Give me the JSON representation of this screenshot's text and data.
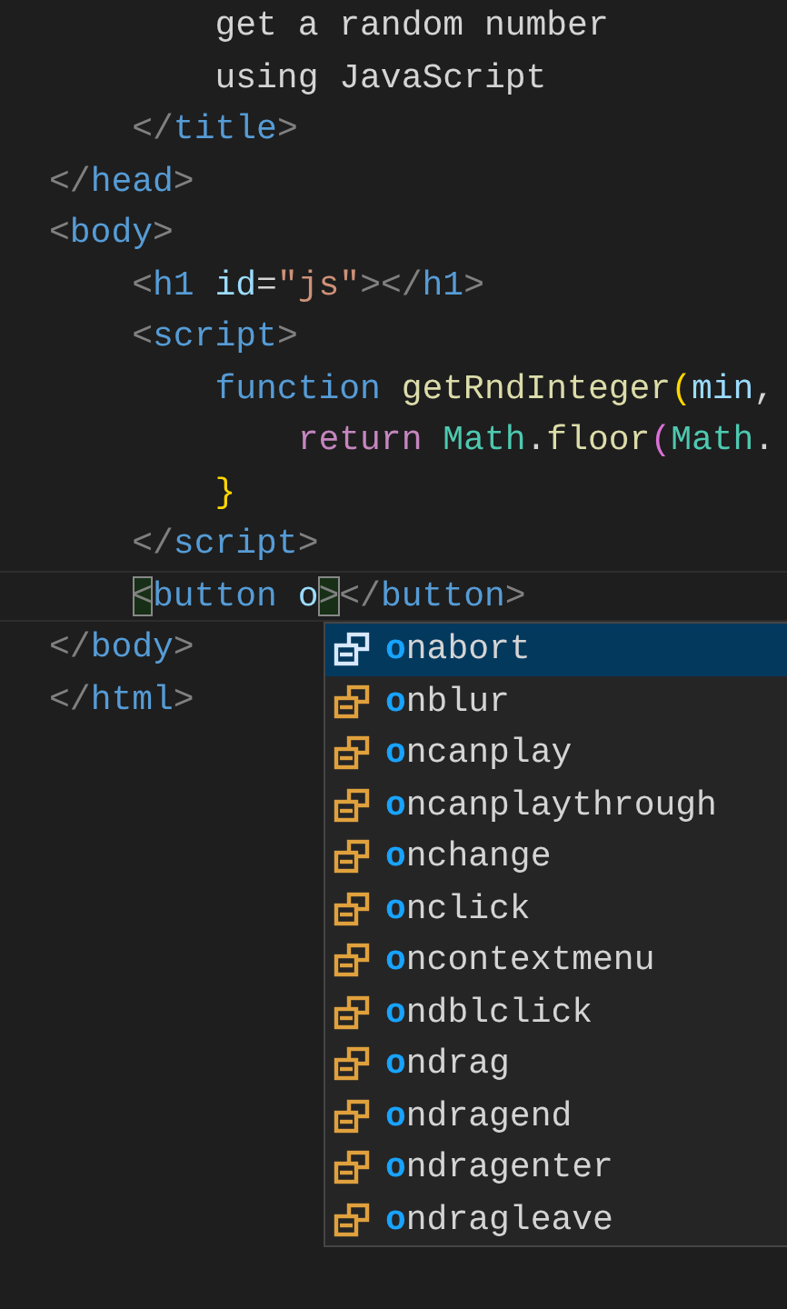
{
  "editor": {
    "lines": [
      {
        "current": false,
        "tokens": [
          {
            "kind": "text",
            "text": "        get a random number"
          }
        ]
      },
      {
        "current": false,
        "tokens": [
          {
            "kind": "text",
            "text": "        using JavaScript"
          }
        ]
      },
      {
        "current": false,
        "tokens": [
          {
            "kind": "punct",
            "text": "    </"
          },
          {
            "kind": "tag",
            "text": "title"
          },
          {
            "kind": "punct",
            "text": ">"
          }
        ]
      },
      {
        "current": false,
        "tokens": [
          {
            "kind": "punct",
            "text": "</"
          },
          {
            "kind": "tag",
            "text": "head"
          },
          {
            "kind": "punct",
            "text": ">"
          }
        ]
      },
      {
        "current": false,
        "tokens": [
          {
            "kind": "punct",
            "text": "<"
          },
          {
            "kind": "tag",
            "text": "body"
          },
          {
            "kind": "punct",
            "text": ">"
          }
        ]
      },
      {
        "current": false,
        "tokens": [
          {
            "kind": "punct",
            "text": "    <"
          },
          {
            "kind": "tag",
            "text": "h1"
          },
          {
            "kind": "attr",
            "text": " id"
          },
          {
            "kind": "text",
            "text": "="
          },
          {
            "kind": "string",
            "text": "\"js\""
          },
          {
            "kind": "punct",
            "text": "></"
          },
          {
            "kind": "tag",
            "text": "h1"
          },
          {
            "kind": "punct",
            "text": ">"
          }
        ]
      },
      {
        "current": false,
        "tokens": [
          {
            "kind": "punct",
            "text": "    <"
          },
          {
            "kind": "tag",
            "text": "script"
          },
          {
            "kind": "punct",
            "text": ">"
          }
        ]
      },
      {
        "current": false,
        "tokens": [
          {
            "kind": "keyword",
            "text": "        function "
          },
          {
            "kind": "func",
            "text": "getRndInteger"
          },
          {
            "kind": "paren",
            "text": "("
          },
          {
            "kind": "attr",
            "text": "min"
          },
          {
            "kind": "text",
            "text": ","
          }
        ]
      },
      {
        "current": false,
        "tokens": [
          {
            "kind": "control",
            "text": "            return "
          },
          {
            "kind": "class",
            "text": "Math"
          },
          {
            "kind": "text",
            "text": "."
          },
          {
            "kind": "func",
            "text": "floor"
          },
          {
            "kind": "paren2",
            "text": "("
          },
          {
            "kind": "class",
            "text": "Math"
          },
          {
            "kind": "text",
            "text": "."
          }
        ]
      },
      {
        "current": false,
        "tokens": [
          {
            "kind": "paren",
            "text": "        }"
          }
        ]
      },
      {
        "current": false,
        "tokens": [
          {
            "kind": "punct",
            "text": "    </"
          },
          {
            "kind": "tag",
            "text": "script"
          },
          {
            "kind": "punct",
            "text": ">"
          }
        ]
      },
      {
        "current": true,
        "tokens": [
          {
            "kind": "punct",
            "text": "    <",
            "matched": true
          },
          {
            "kind": "tag",
            "text": "button"
          },
          {
            "kind": "attr",
            "text": " o"
          },
          {
            "kind": "punct",
            "text": ">",
            "matched": true
          },
          {
            "kind": "punct",
            "text": "</"
          },
          {
            "kind": "tag",
            "text": "button"
          },
          {
            "kind": "punct",
            "text": ">"
          }
        ]
      },
      {
        "current": false,
        "tokens": [
          {
            "kind": "punct",
            "text": "</"
          },
          {
            "kind": "tag",
            "text": "body"
          },
          {
            "kind": "punct",
            "text": ">"
          }
        ]
      },
      {
        "current": false,
        "tokens": [
          {
            "kind": "punct",
            "text": "</"
          },
          {
            "kind": "tag",
            "text": "html"
          },
          {
            "kind": "punct",
            "text": ">"
          }
        ]
      }
    ]
  },
  "suggestions": [
    {
      "label": "**o**nabort",
      "selected": true
    },
    {
      "label": "**o**nblur",
      "selected": false
    },
    {
      "label": "**o**ncanplay",
      "selected": false
    },
    {
      "label": "**o**ncanplaythrough",
      "selected": false
    },
    {
      "label": "**o**nchange",
      "selected": false
    },
    {
      "label": "**o**nclick",
      "selected": false
    },
    {
      "label": "**o**ncontextmenu",
      "selected": false
    },
    {
      "label": "**o**ndblclick",
      "selected": false
    },
    {
      "label": "**o**ndrag",
      "selected": false
    },
    {
      "label": "**o**ndragend",
      "selected": false
    },
    {
      "label": "**o**ndragenter",
      "selected": false
    },
    {
      "label": "**o**ndragleave",
      "selected": false
    }
  ]
}
